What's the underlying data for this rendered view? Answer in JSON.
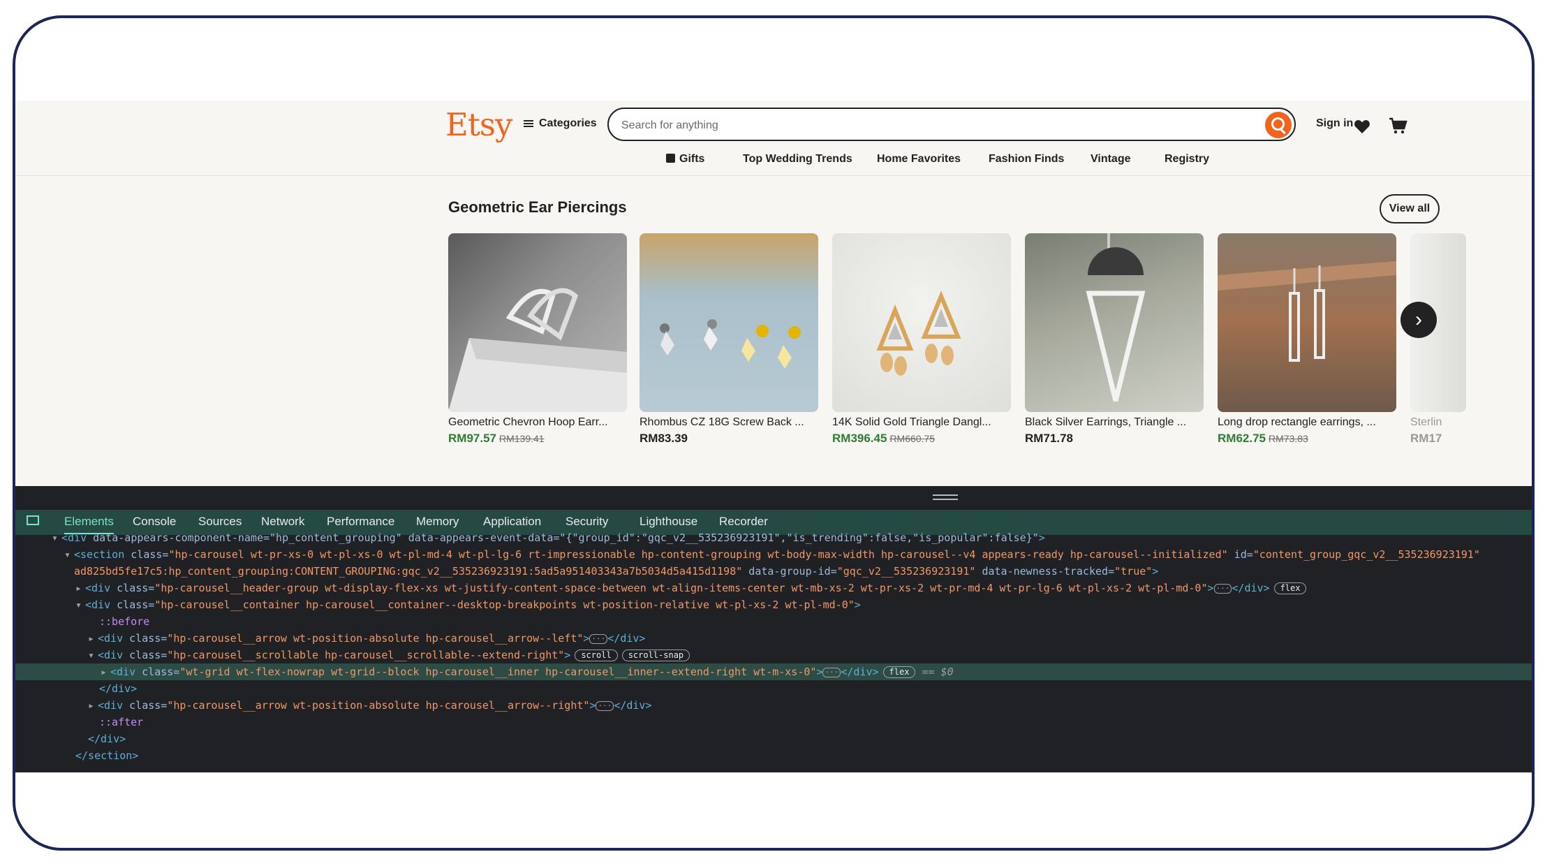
{
  "etsy": {
    "logo": "Etsy",
    "categories_label": "Categories",
    "search_placeholder": "Search for anything",
    "signin_label": "Sign in",
    "nav": [
      "Gifts",
      "Top Wedding Trends",
      "Home Favorites",
      "Fashion Finds",
      "Vintage",
      "Registry"
    ],
    "section_title": "Geometric Ear Piercings",
    "view_all_label": "View all",
    "accent_color": "#f1641e",
    "sale_color": "#2f7d32",
    "products": [
      {
        "title": "Geometric Chevron Hoop Earr...",
        "price": "RM97.57",
        "original": "RM139.41",
        "on_sale": true
      },
      {
        "title": "Rhombus CZ 18G Screw Back ...",
        "price": "RM83.39",
        "original": "",
        "on_sale": false
      },
      {
        "title": "14K Solid Gold Triangle Dangl...",
        "price": "RM396.45",
        "original": "RM660.75",
        "on_sale": true
      },
      {
        "title": "Black Silver Earrings, Triangle ...",
        "price": "RM71.78",
        "original": "",
        "on_sale": false
      },
      {
        "title": "Long drop rectangle earrings, ...",
        "price": "RM62.75",
        "original": "RM73.83",
        "on_sale": true
      },
      {
        "title": "Sterlin",
        "price": "RM17",
        "original": "",
        "on_sale": false
      }
    ]
  },
  "devtools": {
    "tabs": [
      "Elements",
      "Console",
      "Sources",
      "Network",
      "Performance",
      "Memory",
      "Application",
      "Security",
      "Lighthouse",
      "Recorder"
    ],
    "active_tab": "Elements",
    "lines": {
      "l0_attrs": "data-appears-component-name=\"hp_content_grouping\" data-appears-event-data=\"{\"group_id\":\"gqc_v2__535236923191\",\"is_trending\":false,\"is_popular\":false}\"",
      "l1_class": "hp-carousel wt-pr-xs-0 wt-pl-xs-0 wt-pl-md-4 wt-pl-lg-6 rt-impressionable hp-content-grouping wt-body-max-width hp-carousel--v4 appears-ready hp-carousel--initialized",
      "l1_id": "content_group_gqc_v2__535236923191",
      "l2_text": "ad825bd5fe17c5:hp_content_grouping:CONTENT_GROUPING:gqc_v2__535236923191:5ad5a951403343a7b5034d5a415d1198\"",
      "l2_group": "gqc_v2__535236923191",
      "l2_newness": "true",
      "l3_class": "hp-carousel__header-group wt-display-flex-xs wt-justify-content-space-between wt-align-items-center wt-mb-xs-2 wt-pr-xs-2 wt-pr-md-4 wt-pr-lg-6 wt-pl-xs-2 wt-pl-md-0",
      "l4_class": "hp-carousel__container hp-carousel__container--desktop-breakpoints wt-position-relative wt-pl-xs-2 wt-pl-md-0",
      "l5": "::before",
      "l6_class": "hp-carousel__arrow wt-position-absolute hp-carousel__arrow--left",
      "l7_class": "hp-carousel__scrollable hp-carousel__scrollable--extend-right",
      "l8_class": "wt-grid wt-flex-nowrap wt-grid--block hp-carousel__inner hp-carousel__inner--extend-right wt-m-xs-0",
      "l9": "</div>",
      "l10_class": "hp-carousel__arrow wt-position-absolute hp-carousel__arrow--right",
      "l11": "::after",
      "l12": "</div>",
      "l13": "</section>",
      "badge_flex": "flex",
      "badge_scroll": "scroll",
      "badge_scroll_snap": "scroll-snap",
      "selected_marker": "== $0"
    }
  }
}
